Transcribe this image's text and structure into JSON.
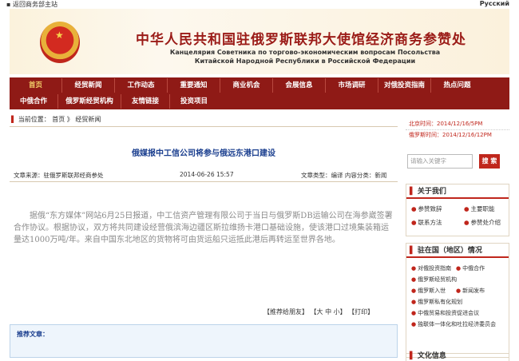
{
  "topbar": {
    "back_label": "返回商务部主站",
    "lang_label": "Русский"
  },
  "header": {
    "title_cn": "中华人民共和国驻俄罗斯联邦大使馆经济商务参赞处",
    "title_ru1": "Канцелярия Советника по торгово-экономическим вопросам Посольства",
    "title_ru2": "Китайской Народной Республики в Российской Федерации"
  },
  "nav": {
    "row1": [
      "首页",
      "经贸新闻",
      "工作动态",
      "重要通知",
      "商业机会",
      "会展信息",
      "市场调研",
      "对俄投资指南",
      "热点问题"
    ],
    "row2": [
      "中俄合作",
      "俄罗斯经贸机构",
      "友情链接",
      "投资项目"
    ]
  },
  "breadcrumb": {
    "label": "当前位置：",
    "home": "首页",
    "sep": "》",
    "current": "经贸新闻"
  },
  "article": {
    "title": "俄媒报中工信公司将参与俄远东港口建设",
    "source": "文章来源：驻俄罗斯联邦经商参处",
    "date": "2014-06-26 15:57",
    "font_label": "文章类型：编译 内容分类：新闻",
    "body": "据俄“东方媒体”网站6月25日报道，中工信资产管理有限公司于当日与俄罗斯DB运输公司在海参崴签署合作协议。根据协议，双方将共同建设经营俄滨海边疆区斯拉维扬卡港口基础设施，使该港口过境集装箱运量达1000万吨/年。来自中国东北地区的货物将可由货运船只运抵此港后再转运至世界各地。",
    "tools": "【推荐给朋友】 【大 中 小】 【打印】"
  },
  "recommend": {
    "label": "推荐文章："
  },
  "sidebar": {
    "beijing_time": "北京时间：2014/12/16/5PM",
    "moscow_time": "俄罗斯时间：2014/12/16/12PM",
    "search_placeholder": "请输入关键字",
    "search_button": "搜 索",
    "about_title": "关于我们",
    "about_items": [
      "参赞致辞",
      "主要职能",
      "联系方法",
      "参赞处介绍"
    ],
    "host_title": "驻在国（地区）情况",
    "host_items": [
      "对俄投资指南",
      "中俄合作",
      "俄罗斯经贸机构",
      "俄罗斯入世",
      "新闻发布",
      "俄罗斯私有化规划",
      "中俄贸易和投资促进会议",
      "独联体一体化和吐拉经济委员会"
    ],
    "extra_title": "文化信息"
  },
  "colors": {
    "brand_red": "#8f1a16",
    "accent_red": "#c0261c",
    "title_blue": "#1b3f8f"
  }
}
